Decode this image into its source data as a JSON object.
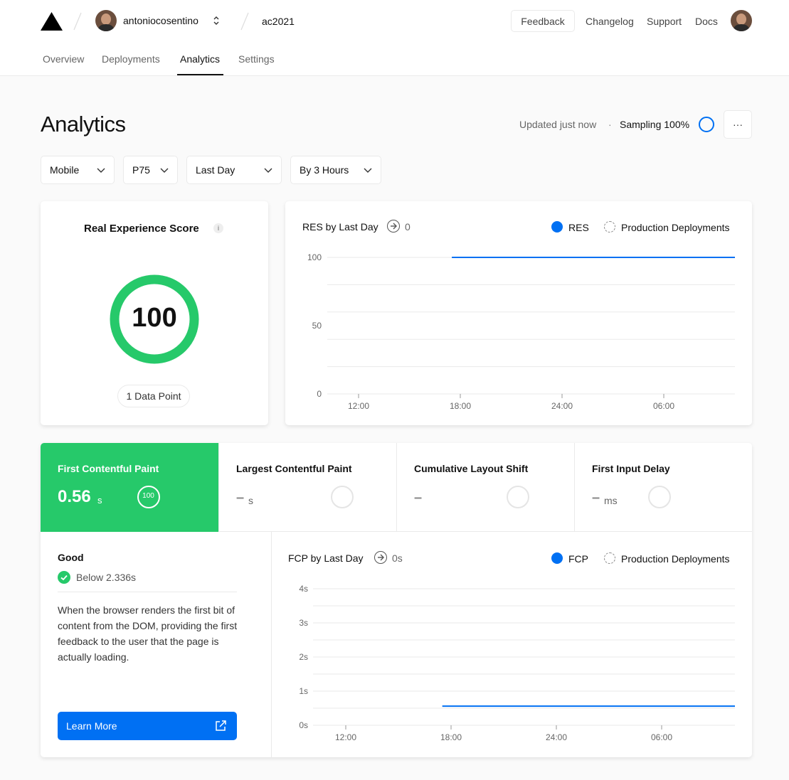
{
  "header": {
    "team": "antoniocosentino",
    "project": "ac2021",
    "feedback": "Feedback",
    "nav": [
      "Changelog",
      "Support",
      "Docs"
    ]
  },
  "tabs": [
    "Overview",
    "Deployments",
    "Analytics",
    "Settings"
  ],
  "active_tab": "Analytics",
  "page": {
    "title": "Analytics",
    "updated": "Updated just now",
    "separator": "·",
    "sampling": "Sampling 100%",
    "more": "···"
  },
  "filters": [
    "Mobile",
    "P75",
    "Last Day",
    "By 3 Hours"
  ],
  "score_card": {
    "title": "Real Experience Score",
    "info": "i",
    "score": "100",
    "data_points": "1 Data Point"
  },
  "res_chart": {
    "title": "RES by Last Day",
    "delta": "0",
    "legend": [
      "RES",
      "Production Deployments"
    ]
  },
  "metrics": [
    {
      "name": "First Contentful Paint",
      "value": "0.56",
      "unit": "s",
      "score": "100"
    },
    {
      "name": "Largest Contentful Paint",
      "value": "–",
      "unit": "s"
    },
    {
      "name": "Cumulative Layout Shift",
      "value": "–",
      "unit": ""
    },
    {
      "name": "First Input Delay",
      "value": "–",
      "unit": "ms"
    }
  ],
  "detail": {
    "status": "Good",
    "threshold": "Below 2.336s",
    "description": "When the browser renders the first bit of content from the DOM, providing the first feedback to the user that the page is actually loading.",
    "learn_more": "Learn More"
  },
  "fcp_chart": {
    "title": "FCP by Last Day",
    "delta": "0s",
    "legend": [
      "FCP",
      "Production Deployments"
    ]
  },
  "colors": {
    "accent": "#0070f3",
    "good": "#26c96a"
  },
  "chart_data": [
    {
      "type": "line",
      "title": "RES by Last Day",
      "x_ticks": [
        "12:00",
        "18:00",
        "24:00",
        "06:00"
      ],
      "y_ticks": [
        "0",
        "50",
        "100"
      ],
      "ylim": [
        0,
        100
      ],
      "series": [
        {
          "name": "RES",
          "x": [
            "17:30",
            "09:30"
          ],
          "values": [
            100,
            100
          ]
        }
      ],
      "grid": true,
      "legend_position": "top-right"
    },
    {
      "type": "line",
      "title": "FCP by Last Day",
      "x_ticks": [
        "12:00",
        "18:00",
        "24:00",
        "06:00"
      ],
      "y_ticks": [
        "0s",
        "1s",
        "2s",
        "3s",
        "4s"
      ],
      "ylim": [
        0,
        4
      ],
      "series": [
        {
          "name": "FCP",
          "x": [
            "17:30",
            "09:30"
          ],
          "values": [
            0.56,
            0.56
          ]
        }
      ],
      "grid": true,
      "legend_position": "top-right"
    }
  ]
}
